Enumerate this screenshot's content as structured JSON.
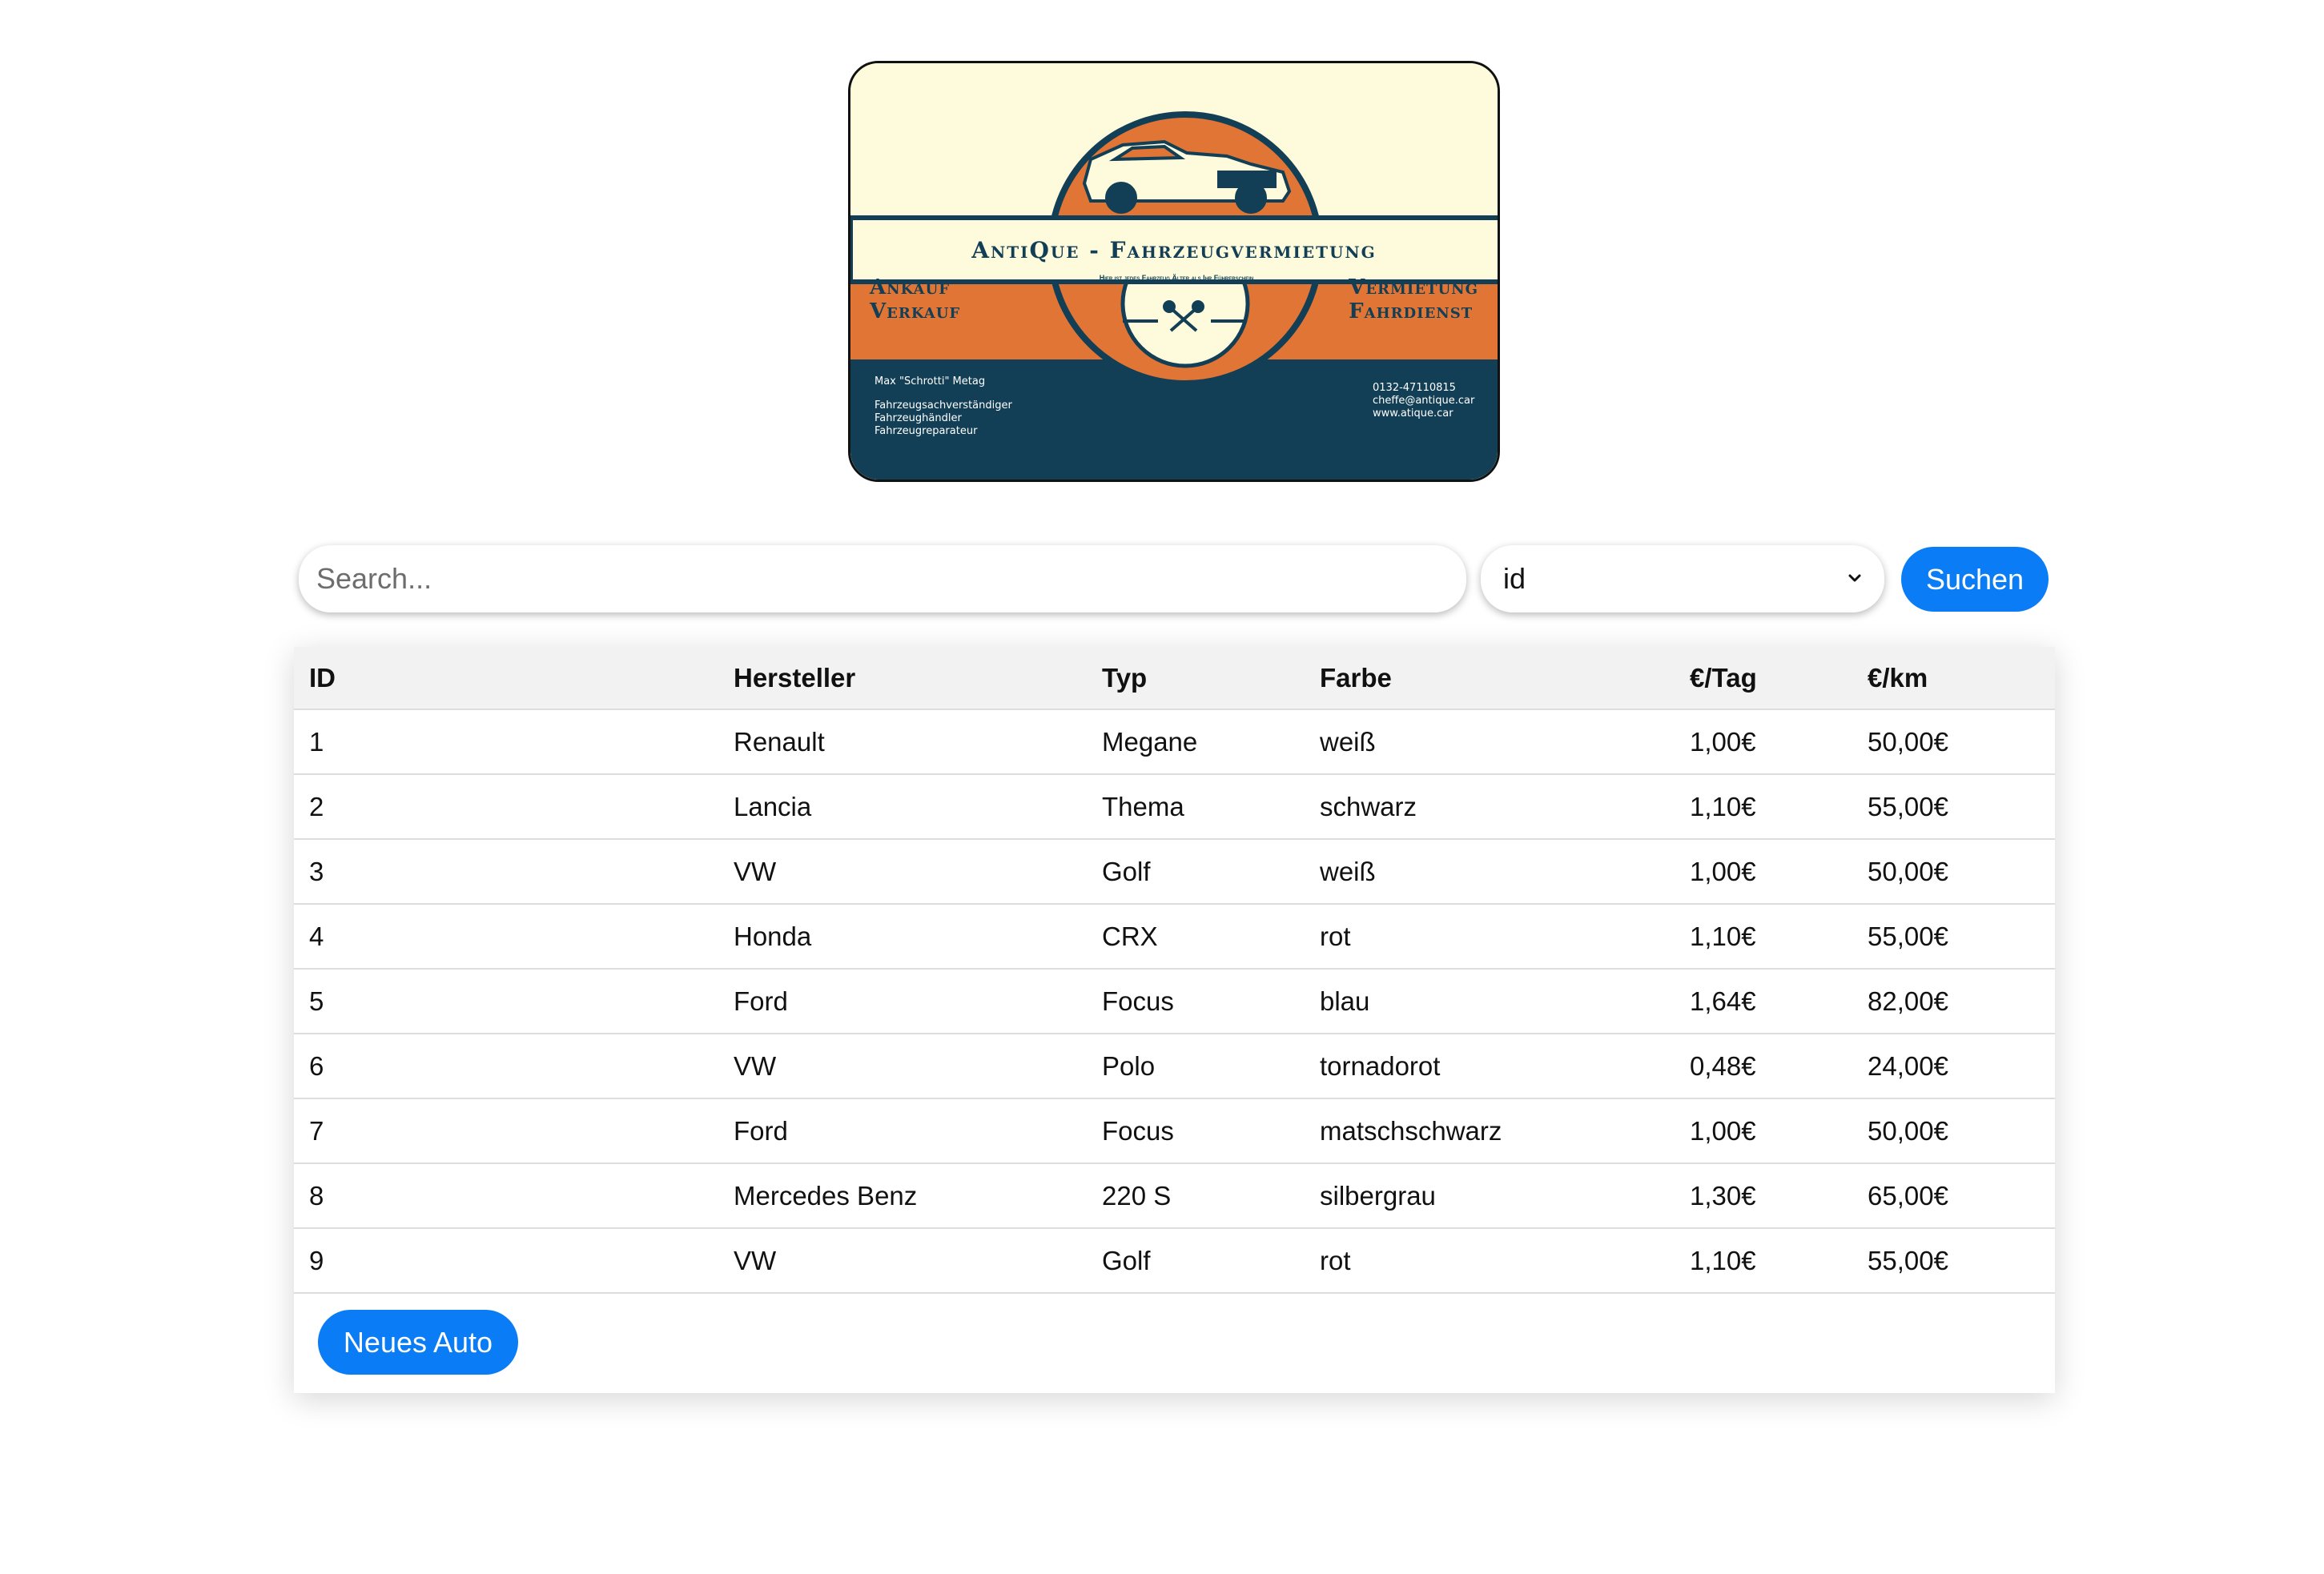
{
  "logo": {
    "title": "AntiQue - Fahrzeugvermietung",
    "left_banner": [
      "Ankauf",
      "Verkauf"
    ],
    "right_banner": [
      "Vermietung",
      "Fahrdienst"
    ],
    "tagline": "Hier ist jedes Fahrzeug Älter als Ihr Führerschein",
    "owner_name": "Max \"Schrotti\" Metag",
    "roles": [
      "Fahrzeugsachverständiger",
      "Fahrzeughändler",
      "Fahrzeugreparateur"
    ],
    "phone": "0132-47110815",
    "email": "cheffe@antique.car",
    "website": "www.atique.car",
    "colors": {
      "cream": "#fdfbdc",
      "orange": "#e07535",
      "navy": "#123f55"
    }
  },
  "search": {
    "placeholder": "Search...",
    "value": "",
    "field_select": "id",
    "button_label": "Suchen"
  },
  "table": {
    "columns": [
      "ID",
      "Hersteller",
      "Typ",
      "Farbe",
      "€/Tag",
      "€/km"
    ],
    "rows": [
      [
        "1",
        "Renault",
        "Megane",
        "weiß",
        "1,00€",
        "50,00€"
      ],
      [
        "2",
        "Lancia",
        "Thema",
        "schwarz",
        "1,10€",
        "55,00€"
      ],
      [
        "3",
        "VW",
        "Golf",
        "weiß",
        "1,00€",
        "50,00€"
      ],
      [
        "4",
        "Honda",
        "CRX",
        "rot",
        "1,10€",
        "55,00€"
      ],
      [
        "5",
        "Ford",
        "Focus",
        "blau",
        "1,64€",
        "82,00€"
      ],
      [
        "6",
        "VW",
        "Polo",
        "tornadorot",
        "0,48€",
        "24,00€"
      ],
      [
        "7",
        "Ford",
        "Focus",
        "matschschwarz",
        "1,00€",
        "50,00€"
      ],
      [
        "8",
        "Mercedes Benz",
        "220 S",
        "silbergrau",
        "1,30€",
        "65,00€"
      ],
      [
        "9",
        "VW",
        "Golf",
        "rot",
        "1,10€",
        "55,00€"
      ]
    ],
    "new_button_label": "Neues Auto"
  },
  "theme": {
    "accent": "#0a7cf5",
    "header_bg": "#f2f2f2"
  }
}
